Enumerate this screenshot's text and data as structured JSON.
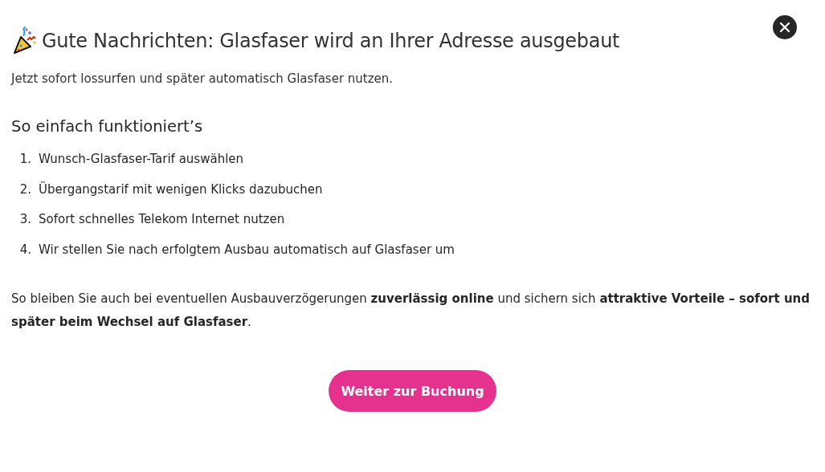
{
  "dialog": {
    "title": "Gute Nachrichten: Glasfaser wird an Ihrer Adresse ausgebaut",
    "subtitle": "Jetzt sofort lossurfen und später automatisch Glasfaser nutzen.",
    "heading": "So einfach funktioniert’s",
    "steps": [
      {
        "number": "1.",
        "text": "Wunsch-Glasfaser-Tarif auswählen"
      },
      {
        "number": "2.",
        "text": "Übergangstarif mit wenigen Klicks dazubuchen"
      },
      {
        "number": "3.",
        "text": "Sofort schnelles Telekom Internet nutzen"
      },
      {
        "number": "4.",
        "text": "Wir stellen Sie nach erfolgtem Ausbau automatisch auf Glasfaser um"
      }
    ],
    "summary": "So bleiben Sie auch bei eventuellen Ausbauverzögerungen **zuverlässig online** und sichern sich **attraktive Vorteile – sofort und später beim Wechsel auf Glasfaser**.",
    "button": "Weiter zur Buchung"
  }
}
